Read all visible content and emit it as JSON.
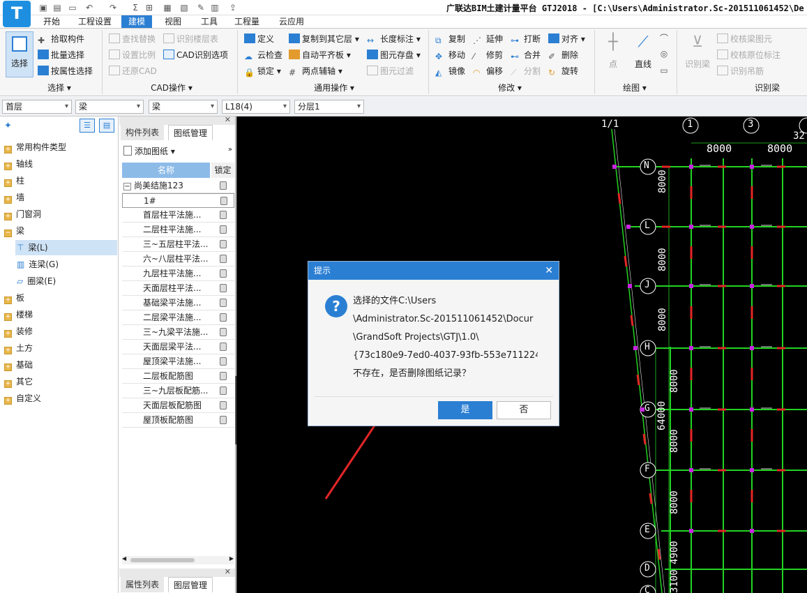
{
  "app": {
    "title": "广联达BIM土建计量平台 GTJ2018 - [C:\\Users\\Administrator.Sc-201511061452\\De"
  },
  "menu": {
    "tabs": [
      "开始",
      "工程设置",
      "建模",
      "视图",
      "工具",
      "工程量",
      "云应用"
    ],
    "active": "建模"
  },
  "ribbon": {
    "select": {
      "big": "选择",
      "items": [
        "拾取构件",
        "批量选择",
        "按属性选择"
      ],
      "group": "选择"
    },
    "cad": {
      "items": [
        "查找替换",
        "设置比例",
        "还原CAD",
        "识别楼层表",
        "CAD识别选项"
      ],
      "group": "CAD操作"
    },
    "general": {
      "items": [
        "定义",
        "云检查",
        "锁定",
        "复制到其它层",
        "自动平齐板",
        "两点辅轴",
        "长度标注",
        "图元存盘",
        "图元过滤"
      ],
      "group": "通用操作"
    },
    "modify": {
      "items": [
        "复制",
        "移动",
        "镜像",
        "延伸",
        "修剪",
        "偏移",
        "打断",
        "合并",
        "分割",
        "对齐",
        "删除",
        "旋转"
      ],
      "group": "修改"
    },
    "draw": {
      "items": [
        "点",
        "直线"
      ],
      "group": "绘图"
    },
    "recog": {
      "big": "识别梁",
      "items": [
        "校核梁图元",
        "校核原位标注",
        "识别吊筋"
      ],
      "group": "识别梁"
    }
  },
  "filters": [
    "首层",
    "梁",
    "梁",
    "L18(4)",
    "分层1"
  ],
  "tree": {
    "items": [
      "常用构件类型",
      "轴线",
      "柱",
      "墙",
      "门窗洞",
      "梁",
      "板",
      "楼梯",
      "装修",
      "土方",
      "基础",
      "其它",
      "自定义"
    ],
    "beam_children": [
      "梁(L)",
      "连梁(G)",
      "圈梁(E)"
    ]
  },
  "panel": {
    "tabs": [
      "构件列表",
      "图纸管理"
    ],
    "add": "添加图纸",
    "col_name": "名称",
    "col_lock": "锁定",
    "root": "尚美结施123",
    "rows": [
      "1#",
      "首层柱平法施...",
      "二层柱平法施...",
      "三~五层柱平法...",
      "六~八层柱平法...",
      "九层柱平法施...",
      "天面层柱平法...",
      "基础梁平法施...",
      "二层梁平法施...",
      "三~九梁平法施...",
      "天面层梁平法...",
      "屋顶梁平法施...",
      "二层板配筋图",
      "三~九层板配筋...",
      "天面层板配筋图",
      "屋顶板配筋图"
    ],
    "bottom_tabs": [
      "属性列表",
      "图层管理"
    ]
  },
  "cad_canvas": {
    "axis_top": [
      "1/1",
      "1",
      "3",
      "32"
    ],
    "axis_left": [
      "N",
      "L",
      "J",
      "H",
      "G",
      "F",
      "E",
      "D",
      "C"
    ],
    "dims_top": [
      "8000",
      "8000"
    ],
    "dims_left": [
      "8000",
      "8000",
      "8000",
      "8000",
      "8000",
      "8000",
      "4900",
      "3100"
    ],
    "total_dim": "64000"
  },
  "dialog": {
    "title": "提示",
    "lines": [
      "选择的文件C:\\Users",
      "\\Administrator.Sc-201511061452\\Docur",
      "\\GrandSoft Projects\\GTJ\\1.0\\",
      "{73c180e9-7ed0-4037-93fb-553e711224",
      "不存在，是否删除图纸记录？"
    ],
    "yes": "是",
    "no": "否"
  },
  "colors": {
    "accent": "#2b7fd3",
    "cad_grid": "#22d322",
    "annotation": "#e32626"
  }
}
